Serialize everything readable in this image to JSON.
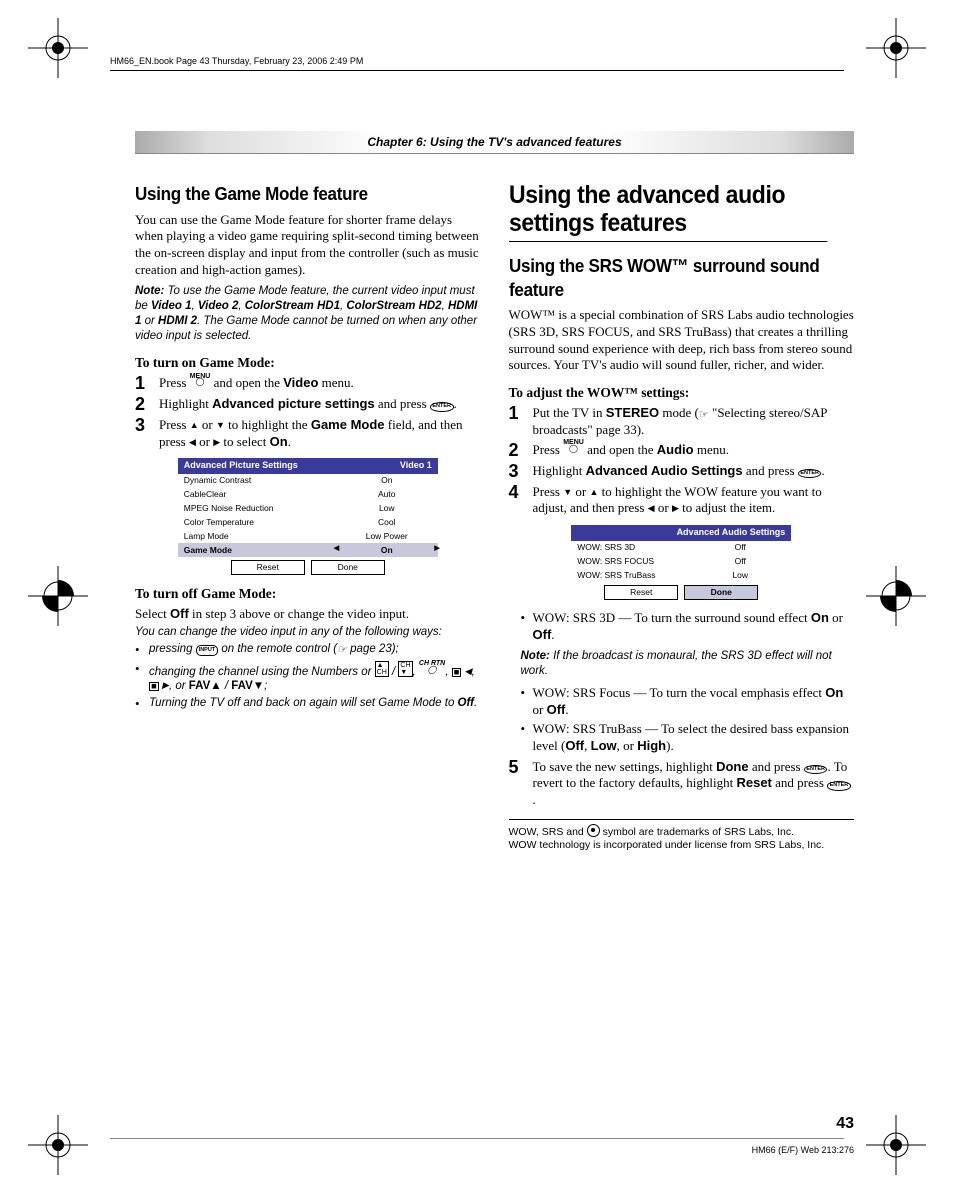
{
  "meta": {
    "header_line": "HM66_EN.book  Page 43  Thursday, February 23, 2006  2:49 PM",
    "chapter": "Chapter 6: Using the TV's advanced features",
    "page_number": "43",
    "footer_code": "HM66 (E/F) Web 213:276"
  },
  "left": {
    "h_game": "Using the Game Mode feature",
    "p_intro": "You can use the Game Mode feature for shorter frame delays when playing a video game requiring split-second timing between the on-screen display and input from the controller (such as music creation and high-action games).",
    "note1_label": "Note:",
    "note1_a": " To use the Game Mode feature, the current video input must be ",
    "note1_v1": "Video 1",
    "note1_c1": ", ",
    "note1_v2": "Video 2",
    "note1_c2": ", ",
    "note1_v3": "ColorStream HD1",
    "note1_c3": ", ",
    "note1_v4": "ColorStream HD2",
    "note1_c4": ", ",
    "note1_v5": "HDMI 1",
    "note1_or": " or ",
    "note1_v6": "HDMI 2",
    "note1_b": ". The Game Mode cannot be turned on when any other video input is selected.",
    "sub_on": "To turn on Game Mode:",
    "s1a": "Press ",
    "menu_label": "MENU",
    "s1b": " and open the ",
    "s1c": "Video",
    "s1d": " menu.",
    "s2a": "Highlight ",
    "s2b": "Advanced picture settings",
    "s2c": " and press ",
    "enter_label": "ENTER",
    "s2d": ".",
    "s3a": "Press ",
    "s3b": " or ",
    "s3c": " to highlight the ",
    "s3d": "Game Mode",
    "s3e": " field, and then press ",
    "s3f": " or ",
    "s3g": " to select ",
    "s3h": "On",
    "s3i": ".",
    "osd1": {
      "title": "Advanced Picture Settings",
      "input": "Video 1",
      "rows": [
        {
          "name": "Dynamic Contrast",
          "val": "On"
        },
        {
          "name": "CableClear",
          "val": "Auto"
        },
        {
          "name": "MPEG Noise Reduction",
          "val": "Low"
        },
        {
          "name": "Color Temperature",
          "val": "Cool"
        },
        {
          "name": "Lamp Mode",
          "val": "Low Power"
        }
      ],
      "sel": {
        "name": "Game Mode",
        "val": "On"
      },
      "reset": "Reset",
      "done": "Done"
    },
    "sub_off": "To turn off Game Mode:",
    "off_a": "Select ",
    "off_b": "Off",
    "off_c": " in step 3 above or change the video input.",
    "off_hint": "You can change the video input in any of the following ways:",
    "b1a": "pressing ",
    "input_label": "INPUT",
    "b1b": " on the remote control (",
    "b1c": " page 23);",
    "b2a": "changing the channel using the Numbers or ",
    "b2b": ", ",
    "chrtn": "CH RTN",
    "b2c": ", ",
    "b2d": ", ",
    "b2e": ", or ",
    "fav_up": "FAV▲",
    "b2f": " / ",
    "fav_dn": "FAV▼",
    "b2g": ";",
    "b3a": "Turning the TV off and back on again will set Game Mode to ",
    "b3b": "Off",
    "b3c": "."
  },
  "right": {
    "h_audio": "Using the advanced audio settings features",
    "h_srs": "Using the SRS WOW™ surround sound feature",
    "p_wow": "WOW™ is a special combination of SRS Labs audio technologies (SRS 3D, SRS FOCUS, and SRS TruBass) that creates a thrilling surround sound experience with deep, rich bass from stereo sound sources. Your TV's audio will sound fuller, richer, and wider.",
    "sub_adjust": "To adjust the WOW™ settings:",
    "r1a": "Put the TV in ",
    "r1b": "STEREO",
    "r1c": " mode (",
    "r1d": " \"Selecting stereo/SAP broadcasts\" page 33).",
    "r2a": "Press ",
    "r2b": " and open the ",
    "r2c": "Audio",
    "r2d": " menu.",
    "r3a": "Highlight ",
    "r3b": "Advanced Audio Settings",
    "r3c": " and press ",
    "r3d": ".",
    "r4a": "Press ",
    "r4b": " or ",
    "r4c": " to highlight the WOW feature you want to adjust, and then press ",
    "r4d": " or ",
    "r4e": " to adjust the item.",
    "osd2": {
      "title": "Advanced Audio Settings",
      "rows": [
        {
          "name": "WOW: SRS 3D",
          "val": "Off"
        },
        {
          "name": "WOW: SRS FOCUS",
          "val": "Off"
        },
        {
          "name": "WOW: SRS TruBass",
          "val": "Low"
        }
      ],
      "reset": "Reset",
      "done": "Done"
    },
    "w1a": "WOW: SRS 3D — To turn the surround sound effect ",
    "w1b": "On",
    "w1c": " or ",
    "w1d": "Off",
    "w1e": ".",
    "note2_label": "Note:",
    "note2": " If the broadcast is monaural, the SRS 3D effect will not work.",
    "w2a": "WOW: SRS Focus — To turn the vocal emphasis effect ",
    "w2b": "On",
    "w2c": " or ",
    "w2d": "Off",
    "w2e": ".",
    "w3a": "WOW: SRS TruBass — To select the desired bass expansion level (",
    "w3b": "Off",
    "w3c": ", ",
    "w3d": "Low",
    "w3e": ", or ",
    "w3f": "High",
    "w3g": ").",
    "r5a": "To save the new settings, highlight ",
    "r5b": "Done",
    "r5c": " and press ",
    "r5d": ". To revert to the factory defaults, highlight ",
    "r5e": "Reset",
    "r5f": " and press ",
    "r5g": ".",
    "fn1": "WOW, SRS and ",
    "fn2": " symbol are trademarks of SRS Labs, Inc.",
    "fn3": "WOW technology is incorporated under license from SRS Labs, Inc."
  }
}
